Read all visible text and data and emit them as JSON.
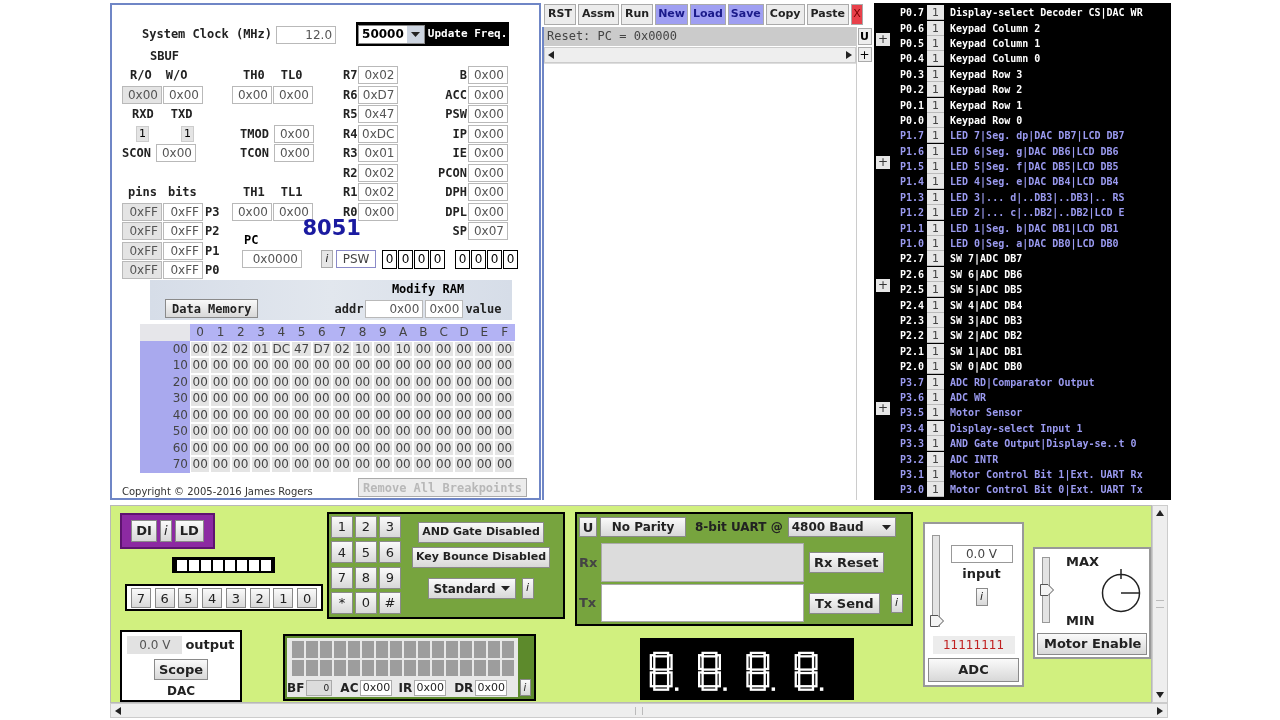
{
  "clock": {
    "label": "System Clock (MHz)",
    "value": "12.0"
  },
  "update_freq": {
    "value": "50000",
    "label": "Update Freq."
  },
  "sbuf": {
    "title": "SBUF",
    "read_label": "R/O",
    "write_label": "W/O",
    "read_value": "0x00",
    "write_value": "0x00"
  },
  "serial_pins": [
    {
      "label": "RXD",
      "value": "1"
    },
    {
      "label": "TXD",
      "value": "1"
    }
  ],
  "scon": {
    "label": "SCON",
    "value": "0x00"
  },
  "timer0": {
    "high_label": "TH0",
    "low_label": "TL0",
    "high": "0x00",
    "low": "0x00"
  },
  "tmod": {
    "label": "TMOD",
    "value": "0x00"
  },
  "tcon": {
    "label": "TCON",
    "value": "0x00"
  },
  "timer1": {
    "high_label": "TH1",
    "low_label": "TL1",
    "high": "0x00",
    "low": "0x00"
  },
  "registers": [
    {
      "label": "R7",
      "value": "0x02"
    },
    {
      "label": "R6",
      "value": "0xD7"
    },
    {
      "label": "R5",
      "value": "0x47"
    },
    {
      "label": "R4",
      "value": "0xDC"
    },
    {
      "label": "R3",
      "value": "0x01"
    },
    {
      "label": "R2",
      "value": "0x02"
    },
    {
      "label": "R1",
      "value": "0x02"
    },
    {
      "label": "R0",
      "value": "0x00"
    }
  ],
  "sfrs": [
    {
      "label": "B",
      "value": "0x00"
    },
    {
      "label": "ACC",
      "value": "0x00"
    },
    {
      "label": "PSW",
      "value": "0x00"
    },
    {
      "label": "IP",
      "value": "0x00"
    },
    {
      "label": "IE",
      "value": "0x00"
    },
    {
      "label": "PCON",
      "value": "0x00"
    },
    {
      "label": "DPH",
      "value": "0x00"
    },
    {
      "label": "DPL",
      "value": "0x00"
    },
    {
      "label": "SP",
      "value": "0x07"
    }
  ],
  "ports": {
    "pins_label": "pins",
    "bits_label": "bits",
    "rows": [
      {
        "pins": "0xFF",
        "bits": "0xFF",
        "label": "P3"
      },
      {
        "pins": "0xFF",
        "bits": "0xFF",
        "label": "P2"
      },
      {
        "pins": "0xFF",
        "bits": "0xFF",
        "label": "P1"
      },
      {
        "pins": "0xFF",
        "bits": "0xFF",
        "label": "P0"
      }
    ]
  },
  "chip_label": "8051",
  "pc": {
    "label": "PC",
    "value": "0x0000"
  },
  "psw": {
    "info": "i",
    "label": "PSW",
    "bits": [
      "0",
      "0",
      "0",
      "0",
      "0",
      "0",
      "0",
      "0"
    ]
  },
  "data_memory_button": "Data Memory",
  "modify_ram": {
    "title": "Modify RAM",
    "addr_label": "addr",
    "addr": "0x00",
    "value": "0x00",
    "value_label": "value"
  },
  "memory": {
    "columns": [
      "0",
      "1",
      "2",
      "3",
      "4",
      "5",
      "6",
      "7",
      "8",
      "9",
      "A",
      "B",
      "C",
      "D",
      "E",
      "F"
    ],
    "rows": [
      {
        "address": "00",
        "cells": [
          "00",
          "02",
          "02",
          "01",
          "DC",
          "47",
          "D7",
          "02",
          "10",
          "00",
          "10",
          "00",
          "00",
          "00",
          "00",
          "00"
        ]
      },
      {
        "address": "10",
        "cells": [
          "00",
          "00",
          "00",
          "00",
          "00",
          "00",
          "00",
          "00",
          "00",
          "00",
          "00",
          "00",
          "00",
          "00",
          "00",
          "00"
        ]
      },
      {
        "address": "20",
        "cells": [
          "00",
          "00",
          "00",
          "00",
          "00",
          "00",
          "00",
          "00",
          "00",
          "00",
          "00",
          "00",
          "00",
          "00",
          "00",
          "00"
        ]
      },
      {
        "address": "30",
        "cells": [
          "00",
          "00",
          "00",
          "00",
          "00",
          "00",
          "00",
          "00",
          "00",
          "00",
          "00",
          "00",
          "00",
          "00",
          "00",
          "00"
        ]
      },
      {
        "address": "40",
        "cells": [
          "00",
          "00",
          "00",
          "00",
          "00",
          "00",
          "00",
          "00",
          "00",
          "00",
          "00",
          "00",
          "00",
          "00",
          "00",
          "00"
        ]
      },
      {
        "address": "50",
        "cells": [
          "00",
          "00",
          "00",
          "00",
          "00",
          "00",
          "00",
          "00",
          "00",
          "00",
          "00",
          "00",
          "00",
          "00",
          "00",
          "00"
        ]
      },
      {
        "address": "60",
        "cells": [
          "00",
          "00",
          "00",
          "00",
          "00",
          "00",
          "00",
          "00",
          "00",
          "00",
          "00",
          "00",
          "00",
          "00",
          "00",
          "00"
        ]
      },
      {
        "address": "70",
        "cells": [
          "00",
          "00",
          "00",
          "00",
          "00",
          "00",
          "00",
          "00",
          "00",
          "00",
          "00",
          "00",
          "00",
          "00",
          "00",
          "00"
        ]
      }
    ]
  },
  "copyright": "Copyright © 2005-2016 James Rogers",
  "remove_breakpoints": {
    "label": "Remove All Breakpoints",
    "disabled": true
  },
  "toolbar": [
    {
      "label": "RST",
      "kind": "plain",
      "highlighted": false
    },
    {
      "label": "Assm",
      "kind": "plain",
      "highlighted": false
    },
    {
      "label": "Run",
      "kind": "plain",
      "highlighted": false
    },
    {
      "label": "New",
      "kind": "plain",
      "highlighted": true
    },
    {
      "label": "Load",
      "kind": "plain",
      "highlighted": true
    },
    {
      "label": "Save",
      "kind": "plain",
      "highlighted": true
    },
    {
      "label": "Copy",
      "kind": "plain",
      "highlighted": false
    },
    {
      "label": "Paste",
      "kind": "plain",
      "highlighted": false
    },
    {
      "label": "X",
      "kind": "close"
    }
  ],
  "editor": {
    "status": "Reset: PC = 0x0000",
    "u_button": "U",
    "plus_button": "+"
  },
  "pin_groups": [
    {
      "expand": "+",
      "color": "#ffffff",
      "pins": [
        {
          "name": "P0.7",
          "value": "1",
          "label": "Display-select Decoder CS|DAC WR"
        },
        {
          "name": "P0.6",
          "value": "1",
          "label": "Keypad Column 2"
        },
        {
          "name": "P0.5",
          "value": "1",
          "label": "Keypad Column 1"
        },
        {
          "name": "P0.4",
          "value": "1",
          "label": "Keypad Column 0"
        },
        {
          "name": "P0.3",
          "value": "1",
          "label": "Keypad Row 3"
        },
        {
          "name": "P0.2",
          "value": "1",
          "label": "Keypad Row 2"
        },
        {
          "name": "P0.1",
          "value": "1",
          "label": "Keypad Row 1"
        },
        {
          "name": "P0.0",
          "value": "1",
          "label": "Keypad Row 0"
        }
      ]
    },
    {
      "expand": "+",
      "color": "#9a9af0",
      "pins": [
        {
          "name": "P1.7",
          "value": "1",
          "label": "LED 7|Seg. dp|DAC DB7|LCD DB7"
        },
        {
          "name": "P1.6",
          "value": "1",
          "label": "LED 6|Seg. g|DAC DB6|LCD DB6"
        },
        {
          "name": "P1.5",
          "value": "1",
          "label": "LED 5|Seg. f|DAC DB5|LCD DB5"
        },
        {
          "name": "P1.4",
          "value": "1",
          "label": "LED 4|Seg. e|DAC DB4|LCD DB4"
        },
        {
          "name": "P1.3",
          "value": "1",
          "label": "LED 3|... d|..DB3|..DB3|.. RS"
        },
        {
          "name": "P1.2",
          "value": "1",
          "label": "LED 2|... c|..DB2|..DB2|LCD E"
        },
        {
          "name": "P1.1",
          "value": "1",
          "label": "LED 1|Seg. b|DAC DB1|LCD DB1"
        },
        {
          "name": "P1.0",
          "value": "1",
          "label": "LED 0|Seg. a|DAC DB0|LCD DB0"
        }
      ]
    },
    {
      "expand": "+",
      "color": "#ffffff",
      "pins": [
        {
          "name": "P2.7",
          "value": "1",
          "label": "SW 7|ADC DB7"
        },
        {
          "name": "P2.6",
          "value": "1",
          "label": "SW 6|ADC DB6"
        },
        {
          "name": "P2.5",
          "value": "1",
          "label": "SW 5|ADC DB5"
        },
        {
          "name": "P2.4",
          "value": "1",
          "label": "SW 4|ADC DB4"
        },
        {
          "name": "P2.3",
          "value": "1",
          "label": "SW 3|ADC DB3"
        },
        {
          "name": "P2.2",
          "value": "1",
          "label": "SW 2|ADC DB2"
        },
        {
          "name": "P2.1",
          "value": "1",
          "label": "SW 1|ADC DB1"
        },
        {
          "name": "P2.0",
          "value": "1",
          "label": "SW 0|ADC DB0"
        }
      ]
    },
    {
      "expand": "+",
      "color": "#9a9af0",
      "pins": [
        {
          "name": "P3.7",
          "value": "1",
          "label": "ADC RD|Comparator Output"
        },
        {
          "name": "P3.6",
          "value": "1",
          "label": "ADC WR"
        },
        {
          "name": "P3.5",
          "value": "1",
          "label": "Motor Sensor"
        },
        {
          "name": "P3.4",
          "value": "1",
          "label": "Display-select Input 1"
        },
        {
          "name": "P3.3",
          "value": "1",
          "label": "AND Gate Output|Display-se..t 0"
        },
        {
          "name": "P3.2",
          "value": "1",
          "label": "ADC INTR"
        },
        {
          "name": "P3.1",
          "value": "1",
          "label": "Motor Control Bit 1|Ext. UART Rx"
        },
        {
          "name": "P3.0",
          "value": "1",
          "label": "Motor Control Bit 0|Ext. UART Tx"
        }
      ]
    }
  ],
  "led_panel": {
    "buttons": [
      "DI",
      "i",
      "LD"
    ],
    "leds": [
      {
        "on": false
      },
      {
        "on": false
      },
      {
        "on": false
      },
      {
        "on": false
      },
      {
        "on": false
      },
      {
        "on": false
      },
      {
        "on": false
      },
      {
        "on": false
      }
    ],
    "switches": [
      "7",
      "6",
      "5",
      "4",
      "3",
      "2",
      "1",
      "0"
    ]
  },
  "dac": {
    "value": "0.0 V",
    "output_label": "output",
    "scope_button": "Scope",
    "title": "DAC"
  },
  "keypad": {
    "keys": [
      "1",
      "2",
      "3",
      "4",
      "5",
      "6",
      "7",
      "8",
      "9",
      "*",
      "0",
      "#"
    ],
    "and_gate_button": "AND Gate Disabled",
    "key_bounce_button": "Key Bounce Disabled",
    "mode": "Standard",
    "info": "i"
  },
  "lcd": {
    "bf_label": "BF",
    "bf": "0",
    "ac_label": "AC",
    "ac": "0x00",
    "ir_label": "IR",
    "ir": "0x00",
    "dr_label": "DR",
    "dr": "0x00",
    "info": "i"
  },
  "uart": {
    "u_button": "U",
    "parity": "No Parity",
    "mode_label": "8-bit UART @",
    "baud": "4800 Baud",
    "rx_label": "Rx",
    "tx_label": "Tx",
    "rx_reset": "Rx Reset",
    "tx_send": "Tx Send",
    "info": "i"
  },
  "adc": {
    "level": 0,
    "value": "0.0 V",
    "input_label": "input",
    "info": "i",
    "bits": "11111111",
    "button": "ADC"
  },
  "motor": {
    "level": 0.5,
    "max_label": "MAX",
    "min_label": "MIN",
    "button": "Motor Enable"
  }
}
